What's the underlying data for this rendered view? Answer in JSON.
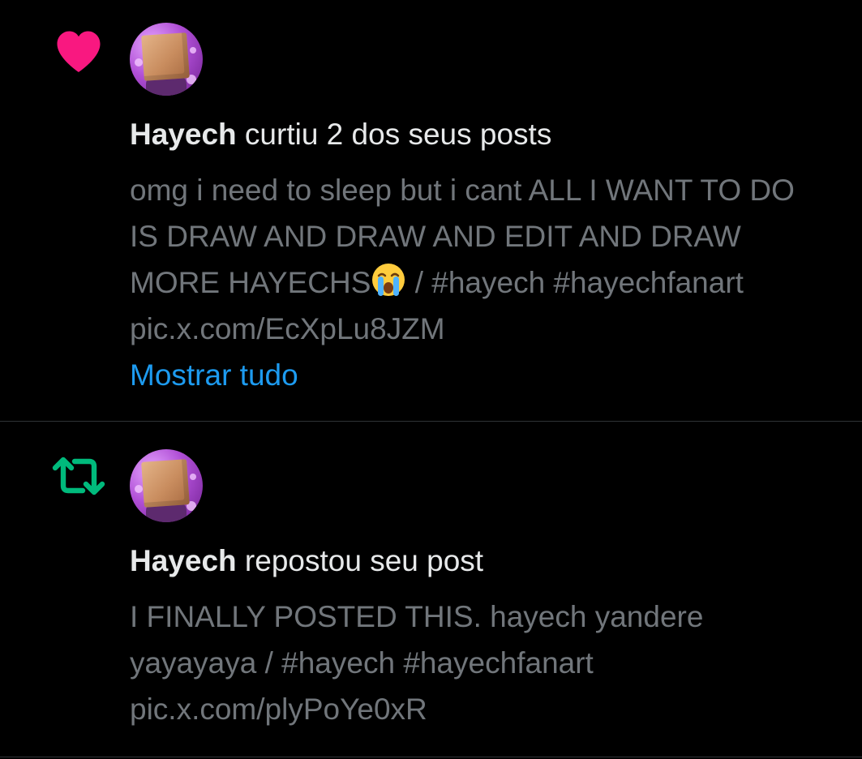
{
  "notifications": [
    {
      "type_icon": "heart-icon",
      "type_color": "#f91880",
      "user_name": "Hayech",
      "action_text": " curtiu 2 dos seus posts",
      "post_text_part1": "omg i need to sleep but i cant ALL I WANT TO DO IS DRAW AND DRAW AND EDIT AND DRAW MORE HAYECHS",
      "emoji": "loudly-crying-face-emoji",
      "post_text_part2": " / #hayech #hayechfanart pic.x.com/EcXpLu8JZM",
      "show_all_label": "Mostrar tudo"
    },
    {
      "type_icon": "repost-icon",
      "type_color": "#00ba7c",
      "user_name": "Hayech",
      "action_text": " repostou seu post",
      "post_text": "I FINALLY POSTED THIS. hayech yandere yayayaya / #hayech #hayechfanart pic.x.com/plyPoYe0xR"
    }
  ],
  "colors": {
    "background": "#000000",
    "primary_text": "#e7e9ea",
    "secondary_text": "#71767b",
    "link": "#1d9bf0",
    "divider": "#2f3336"
  }
}
